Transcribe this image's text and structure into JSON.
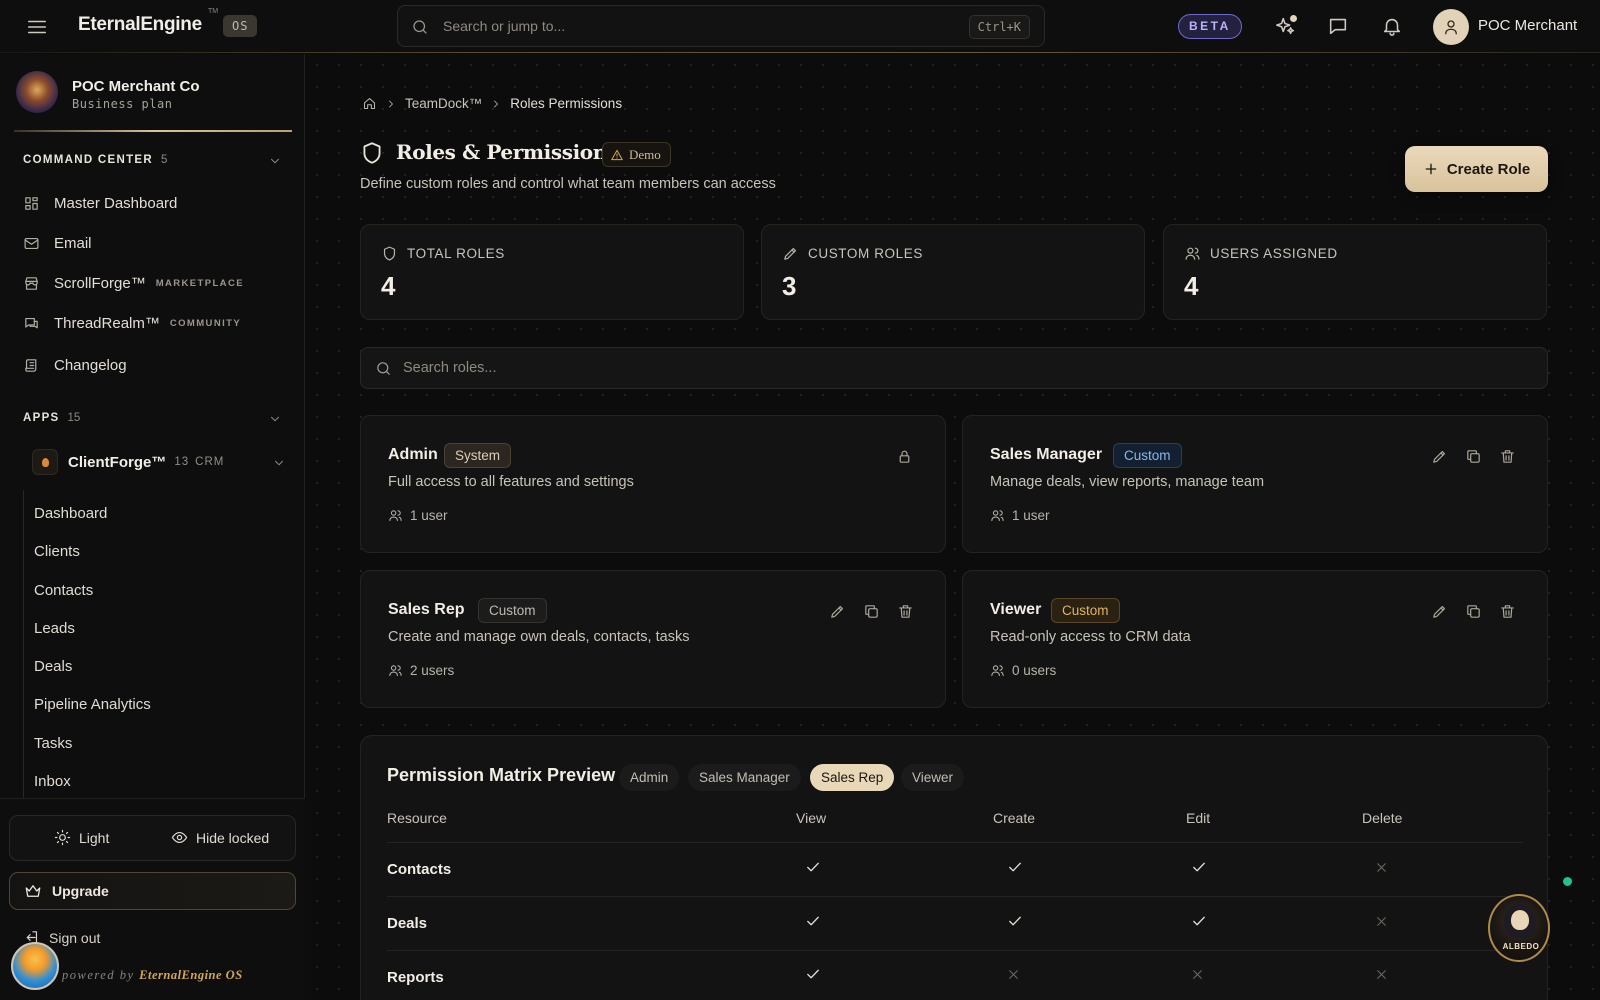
{
  "topbar": {
    "brand": "EternalEngine",
    "brand_tm": "TM",
    "os_badge": "OS",
    "search_placeholder": "Search or jump to...",
    "search_shortcut": "Ctrl+K",
    "beta_label": "BETA",
    "profile_name": "POC Merchant"
  },
  "sidebar": {
    "workspace_name": "POC Merchant Co",
    "workspace_plan": "Business plan",
    "command_center": {
      "label": "COMMAND CENTER",
      "count": "5",
      "items": [
        {
          "label": "Master Dashboard",
          "icon": "grid-icon",
          "tag": ""
        },
        {
          "label": "Email",
          "icon": "mail-icon",
          "tag": ""
        },
        {
          "label": "ScrollForge™",
          "icon": "store-icon",
          "tag": "MARKETPLACE"
        },
        {
          "label": "ThreadRealm™",
          "icon": "chat-icon",
          "tag": "COMMUNITY"
        },
        {
          "label": "Changelog",
          "icon": "scroll-icon",
          "tag": ""
        }
      ]
    },
    "apps": {
      "label": "APPS",
      "count": "15",
      "app_name": "ClientForge™",
      "app_count": "13",
      "app_tag": "CRM",
      "sub_items": [
        "Dashboard",
        "Clients",
        "Contacts",
        "Leads",
        "Deals",
        "Pipeline Analytics",
        "Tasks",
        "Inbox"
      ]
    },
    "theme_label": "Light",
    "hide_locked_label": "Hide locked",
    "upgrade_label": "Upgrade",
    "signout_label": "Sign out",
    "powered_prefix": "powered by",
    "powered_brand": "EternalEngine OS"
  },
  "breadcrumb": {
    "items": [
      "TeamDock™",
      "Roles Permissions"
    ]
  },
  "page": {
    "title": "Roles & Permissions",
    "demo_badge": "Demo",
    "subtitle": "Define custom roles and control what team members can access",
    "create_button": "Create Role"
  },
  "stats": [
    {
      "label": "TOTAL ROLES",
      "value": "4",
      "icon": "shield-icon"
    },
    {
      "label": "CUSTOM ROLES",
      "value": "3",
      "icon": "pencil-icon"
    },
    {
      "label": "USERS ASSIGNED",
      "value": "4",
      "icon": "users-icon"
    }
  ],
  "role_search": {
    "placeholder": "Search roles..."
  },
  "roles": [
    {
      "name": "Admin",
      "badge": "System",
      "description": "Full access to all features and settings",
      "users": "1 user"
    },
    {
      "name": "Sales Manager",
      "badge": "Custom",
      "description": "Manage deals, view reports, manage team",
      "users": "1 user"
    },
    {
      "name": "Sales Rep",
      "badge": "Custom",
      "description": "Create and manage own deals, contacts, tasks",
      "users": "2 users"
    },
    {
      "name": "Viewer",
      "badge": "Custom",
      "description": "Read-only access to CRM data",
      "users": "0 users"
    }
  ],
  "matrix": {
    "title": "Permission Matrix Preview",
    "tabs": [
      "Admin",
      "Sales Manager",
      "Sales Rep",
      "Viewer"
    ],
    "active_tab": "Sales Rep",
    "columns": [
      "Resource",
      "View",
      "Create",
      "Edit",
      "Delete"
    ],
    "rows": [
      {
        "resource": "Contacts",
        "view": true,
        "create": true,
        "edit": true,
        "delete": false
      },
      {
        "resource": "Deals",
        "view": true,
        "create": true,
        "edit": true,
        "delete": false
      },
      {
        "resource": "Reports",
        "view": true,
        "create": false,
        "edit": false,
        "delete": false
      }
    ]
  },
  "assistant": {
    "name": "ALBEDO"
  },
  "colors": {
    "accent": "#e9d8b8",
    "beta": "#b8b3ff",
    "online": "#21c28b"
  }
}
